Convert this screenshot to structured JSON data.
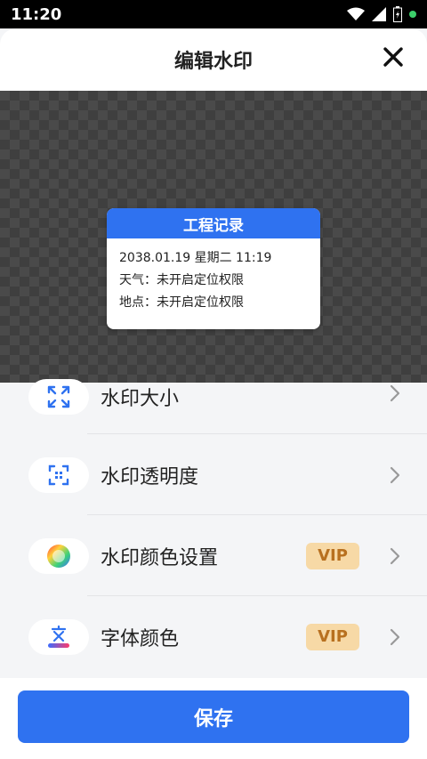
{
  "status_bar": {
    "time": "11:20"
  },
  "header": {
    "title": "编辑水印"
  },
  "watermark": {
    "title": "工程记录",
    "datetime": "2038.01.19 星期二 11:19",
    "weather": "天气：未开启定位权限",
    "location": "地点：未开启定位权限"
  },
  "settings": {
    "items": [
      {
        "label": "水印大小",
        "icon": "resize-icon"
      },
      {
        "label": "水印透明度",
        "icon": "opacity-icon"
      },
      {
        "label": "水印颜色设置",
        "icon": "color-wheel-icon",
        "badge": "VIP"
      },
      {
        "label": "字体颜色",
        "icon": "font-color-icon",
        "badge": "VIP"
      }
    ]
  },
  "footer": {
    "save_label": "保存"
  },
  "colors": {
    "accent": "#2f72f0",
    "vip_bg": "#f7d9a6",
    "vip_text": "#b8701f"
  }
}
